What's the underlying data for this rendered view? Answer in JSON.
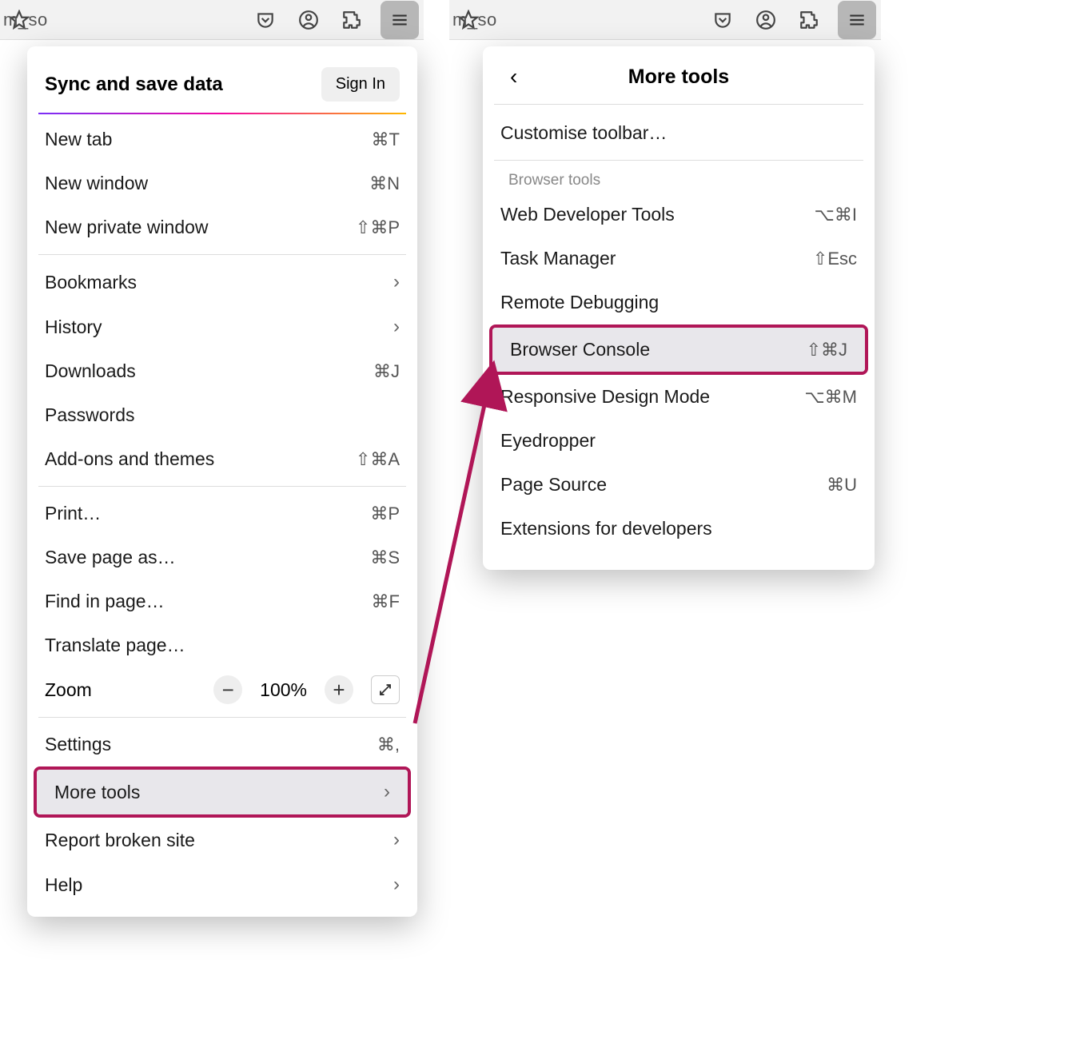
{
  "toolbar": {
    "url_fragment": "m_so"
  },
  "main_menu": {
    "sync_title": "Sync and save data",
    "signin": "Sign In",
    "items": [
      {
        "label": "New tab",
        "shortcut": "⌘T"
      },
      {
        "label": "New window",
        "shortcut": "⌘N"
      },
      {
        "label": "New private window",
        "shortcut": "⇧⌘P"
      }
    ],
    "nav": [
      {
        "label": "Bookmarks",
        "chevron": true
      },
      {
        "label": "History",
        "chevron": true
      },
      {
        "label": "Downloads",
        "shortcut": "⌘J"
      },
      {
        "label": "Passwords"
      },
      {
        "label": "Add-ons and themes",
        "shortcut": "⇧⌘A"
      }
    ],
    "page": [
      {
        "label": "Print…",
        "shortcut": "⌘P"
      },
      {
        "label": "Save page as…",
        "shortcut": "⌘S"
      },
      {
        "label": "Find in page…",
        "shortcut": "⌘F"
      },
      {
        "label": "Translate page…"
      }
    ],
    "zoom": {
      "label": "Zoom",
      "minus": "−",
      "pct": "100%",
      "plus": "+"
    },
    "settings": {
      "label": "Settings",
      "shortcut": "⌘,"
    },
    "more_tools": {
      "label": "More tools"
    },
    "report": {
      "label": "Report broken site"
    },
    "help": {
      "label": "Help"
    }
  },
  "submenu": {
    "title": "More tools",
    "customise": "Customise toolbar…",
    "section": "Browser tools",
    "items": [
      {
        "label": "Web Developer Tools",
        "shortcut": "⌥⌘I"
      },
      {
        "label": "Task Manager",
        "shortcut": "⇧Esc"
      },
      {
        "label": "Remote Debugging"
      },
      {
        "label": "Browser Console",
        "shortcut": "⇧⌘J",
        "highlight": true
      },
      {
        "label": "Responsive Design Mode",
        "shortcut": "⌥⌘M"
      },
      {
        "label": "Eyedropper"
      },
      {
        "label": "Page Source",
        "shortcut": "⌘U"
      },
      {
        "label": "Extensions for developers"
      }
    ]
  }
}
